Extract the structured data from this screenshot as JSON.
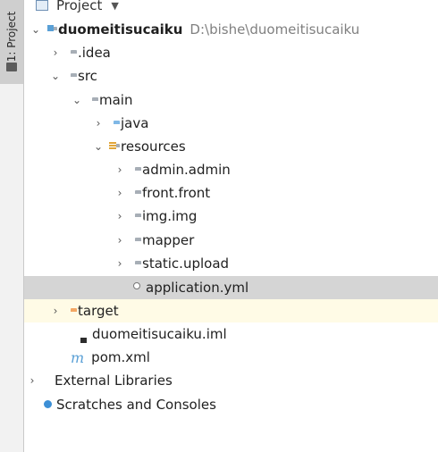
{
  "tool_window": {
    "side_tab_label": "1: Project",
    "title": "Project",
    "chevron": "▼"
  },
  "tree": [
    {
      "name": "project-root",
      "label": "duomeitisucaiku",
      "path": "D:\\bishe\\duomeitisucaiku",
      "arrow": "⌄"
    },
    {
      "name": "idea",
      "label": ".idea",
      "arrow": "›"
    },
    {
      "name": "src",
      "label": "src",
      "arrow": "⌄"
    },
    {
      "name": "main",
      "label": "main",
      "arrow": "⌄"
    },
    {
      "name": "java",
      "label": "java",
      "arrow": "›"
    },
    {
      "name": "resources",
      "label": "resources",
      "arrow": "⌄"
    },
    {
      "name": "admin-admin",
      "label": "admin.admin",
      "arrow": "›"
    },
    {
      "name": "front-front",
      "label": "front.front",
      "arrow": "›"
    },
    {
      "name": "img-img",
      "label": "img.img",
      "arrow": "›"
    },
    {
      "name": "mapper",
      "label": "mapper",
      "arrow": "›"
    },
    {
      "name": "static-upload",
      "label": "static.upload",
      "arrow": "›"
    },
    {
      "name": "application-yml",
      "label": "application.yml"
    },
    {
      "name": "target",
      "label": "target",
      "arrow": "›"
    },
    {
      "name": "iml-file",
      "label": "duomeitisucaiku.iml"
    },
    {
      "name": "pom-file",
      "label": "pom.xml",
      "icon_glyph": "m"
    },
    {
      "name": "external-libraries",
      "label": "External Libraries",
      "arrow": "›"
    },
    {
      "name": "scratches",
      "label": "Scratches and Consoles"
    }
  ],
  "colors": {
    "selected_row": "#d5d5d5",
    "target_row": "#fffbe6",
    "folder_gray": "#a7aeb6",
    "folder_blue": "#7fb8e6",
    "folder_orange": "#f3a764"
  }
}
